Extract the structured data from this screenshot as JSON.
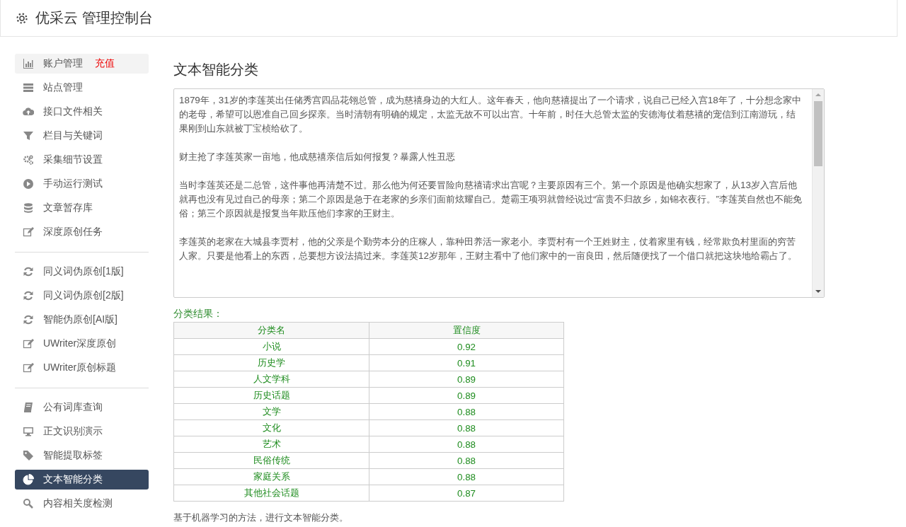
{
  "header": {
    "title": "优采云 管理控制台"
  },
  "sidebar": {
    "groups": [
      [
        {
          "label": "账户管理",
          "badge": "充值",
          "highlighted": true,
          "selected": false
        },
        {
          "label": "站点管理",
          "highlighted": false,
          "selected": false
        },
        {
          "label": "接口文件相关",
          "highlighted": false,
          "selected": false
        },
        {
          "label": "栏目与关键词",
          "highlighted": false,
          "selected": false
        },
        {
          "label": "采集细节设置",
          "highlighted": false,
          "selected": false
        },
        {
          "label": "手动运行测试",
          "highlighted": false,
          "selected": false
        },
        {
          "label": "文章暂存库",
          "highlighted": false,
          "selected": false
        },
        {
          "label": "深度原创任务",
          "highlighted": false,
          "selected": false
        }
      ],
      [
        {
          "label": "同义词伪原创[1版]",
          "highlighted": false,
          "selected": false
        },
        {
          "label": "同义词伪原创[2版]",
          "highlighted": false,
          "selected": false
        },
        {
          "label": "智能伪原创[AI版]",
          "highlighted": false,
          "selected": false
        },
        {
          "label": "UWriter深度原创",
          "highlighted": false,
          "selected": false
        },
        {
          "label": "UWriter原创标题",
          "highlighted": false,
          "selected": false
        }
      ],
      [
        {
          "label": "公有词库查询",
          "highlighted": false,
          "selected": false
        },
        {
          "label": "正文识别演示",
          "highlighted": false,
          "selected": false
        },
        {
          "label": "智能提取标签",
          "highlighted": false,
          "selected": false
        },
        {
          "label": "文本智能分类",
          "highlighted": false,
          "selected": true
        },
        {
          "label": "内容相关度检测",
          "highlighted": false,
          "selected": false
        }
      ]
    ]
  },
  "main": {
    "title": "文本智能分类",
    "text_area": {
      "paragraphs": [
        "1879年，31岁的李莲英出任储秀宫四品花翎总管，成为慈禧身边的大红人。这年春天，他向慈禧提出了一个请求，说自己已经入宫18年了，十分想念家中的老母，希望可以恩准自己回乡探亲。当时清朝有明确的规定，太监无故不可以出宫。十年前，时任大总管太监的安德海仗着慈禧的宠信到江南游玩，结果刚到山东就被丁宝桢给砍了。",
        "财主抢了李莲英家一亩地，他成慈禧亲信后如何报复？暴露人性丑恶",
        "当时李莲英还是二总管，这件事他再清楚不过。那么他为何还要冒险向慈禧请求出宫呢？主要原因有三个。第一个原因是他确实想家了，从13岁入宫后他就再也没有见过自己的母亲；第二个原因是急于在老家的乡亲们面前炫耀自己。楚霸王项羽就曾经说过“富贵不归故乡，如锦衣夜行。”李莲英自然也不能免俗；第三个原因就是报复当年欺压他们李家的王财主。",
        "李莲英的老家在大城县李贾村，他的父亲是个勤劳本分的庄稼人，靠种田养活一家老小。李贾村有一个王姓财主，仗着家里有钱，经常欺负村里面的穷苦人家。只要是他看上的东西，总要想方设法搞过来。李莲英12岁那年，王财主看中了他们家中的一亩良田，然后随便找了一个借口就把这块地给霸占了。"
      ]
    },
    "result_label": "分类结果：",
    "table": {
      "columns": [
        "分类名",
        "置信度"
      ],
      "rows": [
        [
          "小说",
          "0.92"
        ],
        [
          "历史学",
          "0.91"
        ],
        [
          "人文学科",
          "0.89"
        ],
        [
          "历史话题",
          "0.89"
        ],
        [
          "文学",
          "0.88"
        ],
        [
          "文化",
          "0.88"
        ],
        [
          "艺术",
          "0.88"
        ],
        [
          "民俗传统",
          "0.88"
        ],
        [
          "家庭关系",
          "0.88"
        ],
        [
          "其他社会话题",
          "0.87"
        ]
      ]
    },
    "footnote": "基于机器学习的方法，进行文本智能分类。"
  }
}
